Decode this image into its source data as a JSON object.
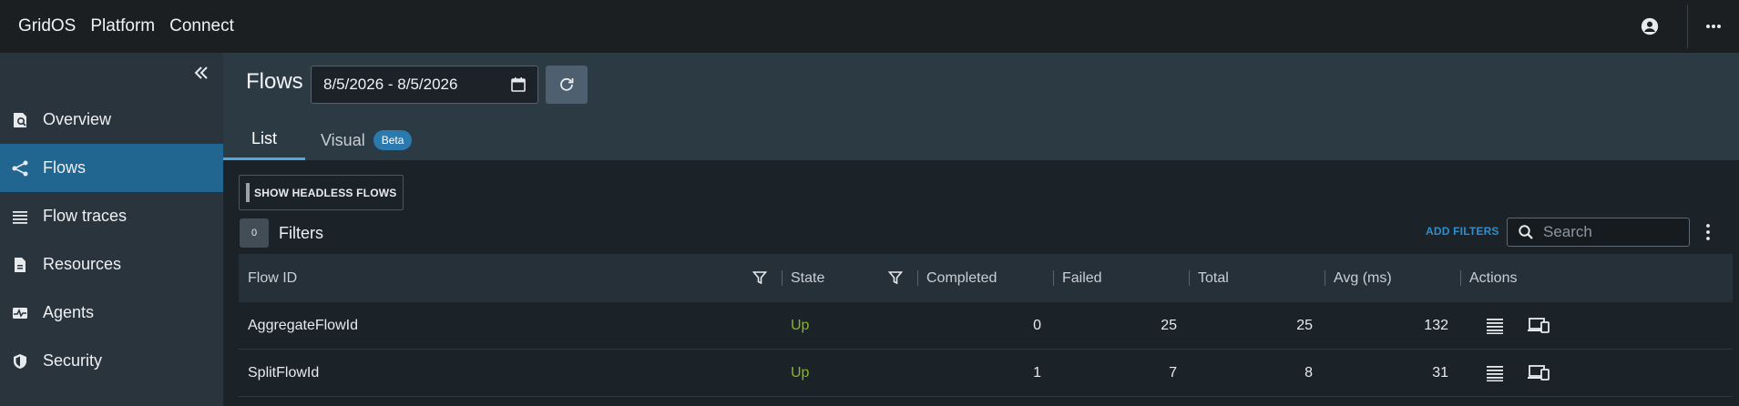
{
  "topbar": {
    "brand": [
      "GridOS",
      "Platform",
      "Connect"
    ]
  },
  "sidebar": {
    "items": [
      {
        "label": "Overview",
        "icon": "overview-icon"
      },
      {
        "label": "Flows",
        "icon": "flows-icon",
        "active": true
      },
      {
        "label": "Flow traces",
        "icon": "list-icon"
      },
      {
        "label": "Resources",
        "icon": "document-icon"
      },
      {
        "label": "Agents",
        "icon": "pulse-icon"
      },
      {
        "label": "Security",
        "icon": "shield-icon"
      }
    ]
  },
  "header": {
    "title": "Flows",
    "date_range": "8/5/2026 - 8/5/2026"
  },
  "tabs": {
    "list": "List",
    "visual": "Visual",
    "beta": "Beta"
  },
  "toolbar": {
    "headless_button": "SHOW HEADLESS FLOWS",
    "filter_count": "0",
    "filters_label": "Filters",
    "add_filters": "ADD FILTERS",
    "search_placeholder": "Search"
  },
  "table": {
    "columns": [
      "Flow ID",
      "State",
      "Completed",
      "Failed",
      "Total",
      "Avg (ms)",
      "Actions"
    ],
    "rows": [
      {
        "flow_id": "AggregateFlowId",
        "state": "Up",
        "completed": "0",
        "failed": "25",
        "total": "25",
        "avg": "132"
      },
      {
        "flow_id": "SplitFlowId",
        "state": "Up",
        "completed": "1",
        "failed": "7",
        "total": "8",
        "avg": "31"
      }
    ]
  },
  "colors": {
    "accent": "#216690",
    "link": "#2e8fce",
    "state_up": "#86b52b"
  }
}
